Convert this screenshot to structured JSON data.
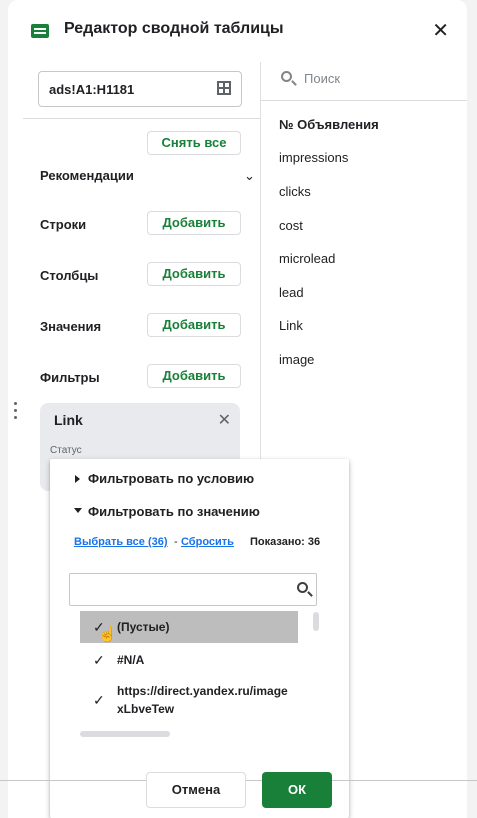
{
  "header": {
    "title": "Редактор сводной таблицы"
  },
  "range": {
    "value": "ads!A1:H1181"
  },
  "actions": {
    "clear_all": "Снять все"
  },
  "sections": {
    "recommendations": "Рекомендации",
    "rows": "Строки",
    "columns": "Столбцы",
    "values": "Значения",
    "filters": "Фильтры",
    "add_label": "Добавить"
  },
  "fields": {
    "search_placeholder": "Поиск",
    "items": [
      "№ Объявления",
      "impressions",
      "clicks",
      "cost",
      "microlead",
      "lead",
      "Link",
      "image"
    ]
  },
  "filter_card": {
    "title": "Link",
    "status_label": "Статус"
  },
  "filter_popup": {
    "by_condition": "Фильтровать по условию",
    "by_value": "Фильтровать по значению",
    "select_all": "Выбрать все (36)",
    "dash": "-",
    "reset": "Сбросить",
    "shown": "Показано: 36",
    "search_value": "",
    "options": [
      {
        "label": "(Пустые)",
        "checked": true
      },
      {
        "label": "#N/A",
        "checked": true
      },
      {
        "label": "https://direct.yandex.ru/image",
        "label2": "xLbveTew",
        "checked": true
      }
    ],
    "cancel": "Отмена",
    "ok": "ОК"
  },
  "colors": {
    "accent": "#188038",
    "link": "#1a73e8",
    "selected": "#bdbdbd"
  }
}
